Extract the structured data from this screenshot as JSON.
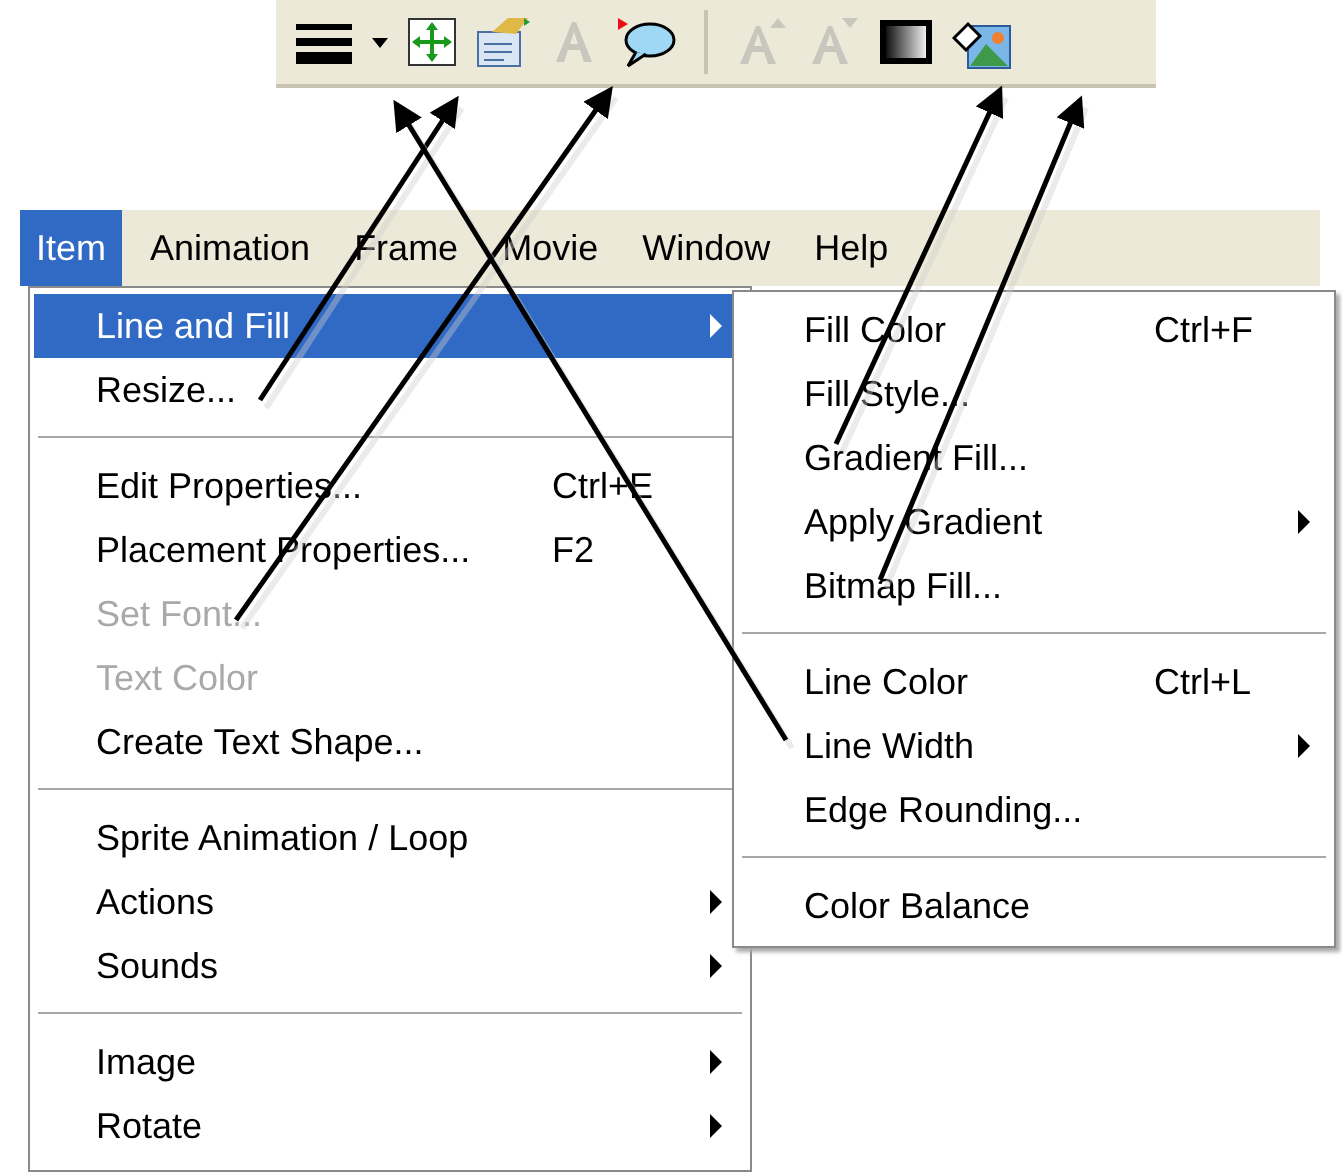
{
  "toolbar": {
    "items": [
      {
        "kind": "line-style",
        "disabled": false
      },
      {
        "kind": "dropdown",
        "disabled": false
      },
      {
        "kind": "fit",
        "disabled": false
      },
      {
        "kind": "properties",
        "disabled": false
      },
      {
        "kind": "font",
        "disabled": true
      },
      {
        "kind": "balloon",
        "disabled": false
      },
      {
        "kind": "separator"
      },
      {
        "kind": "grow-font",
        "disabled": true
      },
      {
        "kind": "shrink-font",
        "disabled": true
      },
      {
        "kind": "gradient",
        "disabled": false
      },
      {
        "kind": "bitmap",
        "disabled": false
      }
    ]
  },
  "menu_bar": {
    "items": [
      {
        "label": "Item",
        "selected": true
      },
      {
        "label": "Animation",
        "selected": false
      },
      {
        "label": "Frame",
        "selected": false
      },
      {
        "label": "Movie",
        "selected": false
      },
      {
        "label": "Window",
        "selected": false
      },
      {
        "label": "Help",
        "selected": false
      }
    ]
  },
  "menu": {
    "items": [
      {
        "kind": "item",
        "label": "Line and Fill",
        "submenu": true,
        "disabled": false,
        "selected": true
      },
      {
        "kind": "item",
        "label": "Resize...",
        "submenu": false,
        "disabled": false,
        "selected": false
      },
      {
        "kind": "separator"
      },
      {
        "kind": "item",
        "label": "Edit Properties...",
        "shortcut": "Ctrl+E",
        "submenu": false,
        "disabled": false,
        "selected": false
      },
      {
        "kind": "item",
        "label": "Placement Properties...",
        "shortcut": "F2",
        "submenu": false,
        "disabled": false,
        "selected": false
      },
      {
        "kind": "item",
        "label": "Set Font...",
        "submenu": false,
        "disabled": true,
        "selected": false
      },
      {
        "kind": "item",
        "label": "Text Color",
        "submenu": false,
        "disabled": true,
        "selected": false
      },
      {
        "kind": "item",
        "label": "Create Text Shape...",
        "submenu": false,
        "disabled": false,
        "selected": false
      },
      {
        "kind": "separator"
      },
      {
        "kind": "item",
        "label": "Sprite Animation / Loop",
        "submenu": false,
        "disabled": false,
        "selected": false
      },
      {
        "kind": "item",
        "label": "Actions",
        "submenu": true,
        "disabled": false,
        "selected": false
      },
      {
        "kind": "item",
        "label": "Sounds",
        "submenu": true,
        "disabled": false,
        "selected": false
      },
      {
        "kind": "separator"
      },
      {
        "kind": "item",
        "label": "Image",
        "submenu": true,
        "disabled": false,
        "selected": false
      },
      {
        "kind": "item",
        "label": "Rotate",
        "submenu": true,
        "disabled": false,
        "selected": false
      }
    ]
  },
  "submenu": {
    "items": [
      {
        "kind": "item",
        "label": "Fill Color",
        "shortcut": "Ctrl+F",
        "submenu": false,
        "disabled": false,
        "selected": false
      },
      {
        "kind": "item",
        "label": "Fill Style...",
        "submenu": false,
        "disabled": false,
        "selected": false
      },
      {
        "kind": "item",
        "label": "Gradient Fill...",
        "submenu": false,
        "disabled": false,
        "selected": false
      },
      {
        "kind": "item",
        "label": "Apply Gradient",
        "submenu": true,
        "disabled": false,
        "selected": false
      },
      {
        "kind": "item",
        "label": "Bitmap Fill...",
        "submenu": false,
        "disabled": false,
        "selected": false
      },
      {
        "kind": "separator"
      },
      {
        "kind": "item",
        "label": "Line Color",
        "shortcut": "Ctrl+L",
        "submenu": false,
        "disabled": false,
        "selected": false
      },
      {
        "kind": "item",
        "label": "Line Width",
        "submenu": true,
        "disabled": false,
        "selected": false
      },
      {
        "kind": "item",
        "label": "Edge Rounding...",
        "submenu": false,
        "disabled": false,
        "selected": false
      },
      {
        "kind": "separator"
      },
      {
        "kind": "item",
        "label": "Color Balance",
        "submenu": false,
        "disabled": false,
        "selected": false
      }
    ]
  }
}
